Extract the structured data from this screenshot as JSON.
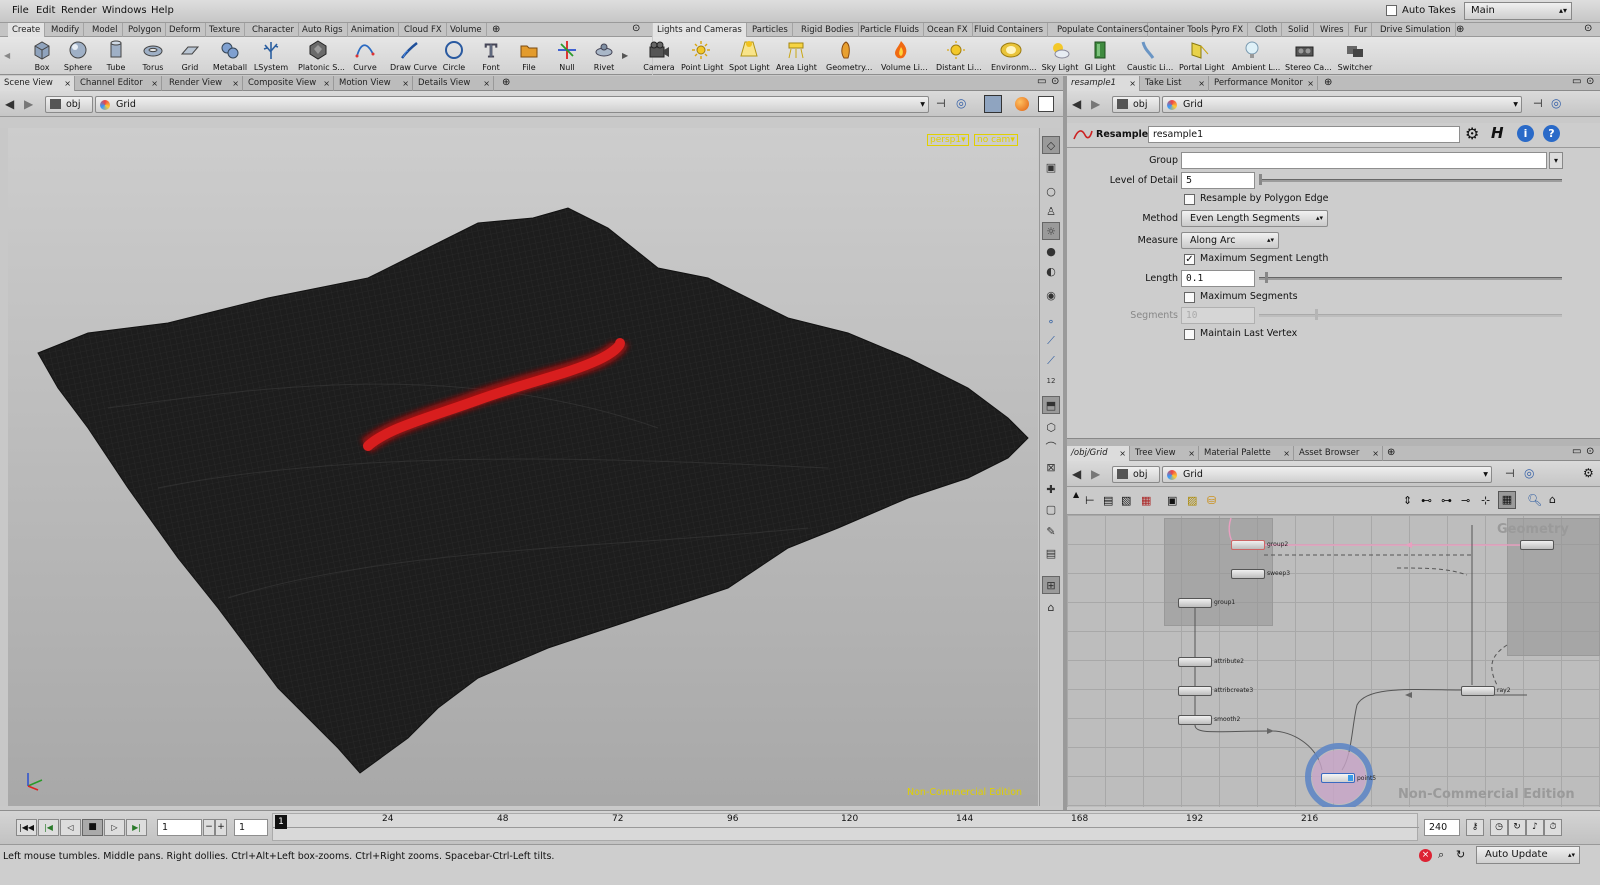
{
  "menu": {
    "items": [
      "File",
      "Edit",
      "Render",
      "Windows",
      "Help"
    ],
    "auto_takes": "Auto Takes",
    "desktop": "Main"
  },
  "shelf_left": {
    "tabs": [
      "Create",
      "Modify",
      "Model",
      "Polygon",
      "Deform",
      "Texture",
      "Character",
      "Auto Rigs",
      "Animation",
      "Cloud FX",
      "Volume"
    ],
    "tools": [
      "Box",
      "Sphere",
      "Tube",
      "Torus",
      "Grid",
      "Metaball",
      "LSystem",
      "Platonic S...",
      "Curve",
      "Draw Curve",
      "Circle",
      "Font",
      "File",
      "Null",
      "Rivet"
    ]
  },
  "shelf_right": {
    "tabs": [
      "Lights and Cameras",
      "Particles",
      "Rigid Bodies",
      "Particle Fluids",
      "Ocean FX",
      "Fluid Containers",
      "Populate Containers",
      "Container Tools",
      "Pyro FX",
      "Cloth",
      "Solid",
      "Wires",
      "Fur",
      "Drive Simulation"
    ],
    "tools": [
      "Camera",
      "Point Light",
      "Spot Light",
      "Area Light",
      "Geometry...",
      "Volume Li...",
      "Distant Li...",
      "Environm...",
      "Sky Light",
      "GI Light",
      "Caustic Li...",
      "Portal Light",
      "Ambient L...",
      "Stereo Ca...",
      "Switcher"
    ]
  },
  "left_pane": {
    "tabs": [
      "Scene View",
      "Channel Editor",
      "Render View",
      "Composite View",
      "Motion View",
      "Details View"
    ],
    "path": {
      "root": "obj",
      "node": "Grid"
    },
    "viewport": {
      "camera": "persp1",
      "cam_menu": "no cam",
      "watermark": "Non-Commercial Edition"
    }
  },
  "param_pane": {
    "tabs": [
      "resample1",
      "Take List",
      "Performance Monitor"
    ],
    "path": {
      "root": "obj",
      "node": "Grid"
    },
    "node_type": "Resample",
    "node_name": "resample1",
    "params": {
      "group_label": "Group",
      "group_value": "",
      "lod_label": "Level of Detail",
      "lod_value": "5",
      "resample_poly_label": "Resample by Polygon Edge",
      "method_label": "Method",
      "method_value": "Even Length Segments",
      "measure_label": "Measure",
      "measure_value": "Along Arc",
      "max_seg_len_label": "Maximum Segment Length",
      "length_label": "Length",
      "length_value": "0.1",
      "max_segs_label": "Maximum Segments",
      "segments_label": "Segments",
      "segments_value": "10",
      "maintain_label": "Maintain Last Vertex"
    },
    "checks": {
      "resample_poly": false,
      "max_seg_len": true,
      "max_segs": false,
      "maintain": false
    }
  },
  "net_pane": {
    "tabs": [
      "/obj/Grid",
      "Tree View",
      "Material Palette",
      "Asset Browser"
    ],
    "path": {
      "root": "obj",
      "node": "Grid"
    },
    "context_label": "Geometry",
    "watermark": "Non-Commercial Edition",
    "nodes": [
      "group1",
      "attribute2",
      "attribcreate3",
      "smooth2",
      "ray2",
      "point5",
      "sweep3",
      "group2"
    ]
  },
  "timeline": {
    "frame": "1",
    "start": "1",
    "end": "240",
    "current_marker": "1",
    "ticks": [
      "24",
      "48",
      "72",
      "96",
      "120",
      "144",
      "168",
      "192",
      "216"
    ]
  },
  "status": {
    "message": "Left mouse tumbles. Middle pans. Right dollies. Ctrl+Alt+Left box-zooms. Ctrl+Right zooms. Spacebar-Ctrl-Left tilts.",
    "update_mode": "Auto Update"
  },
  "colors": {
    "accent_red": "#c8201a",
    "viewport_yellow": "#e0d000",
    "node_highlight": "#e8a0c0"
  }
}
